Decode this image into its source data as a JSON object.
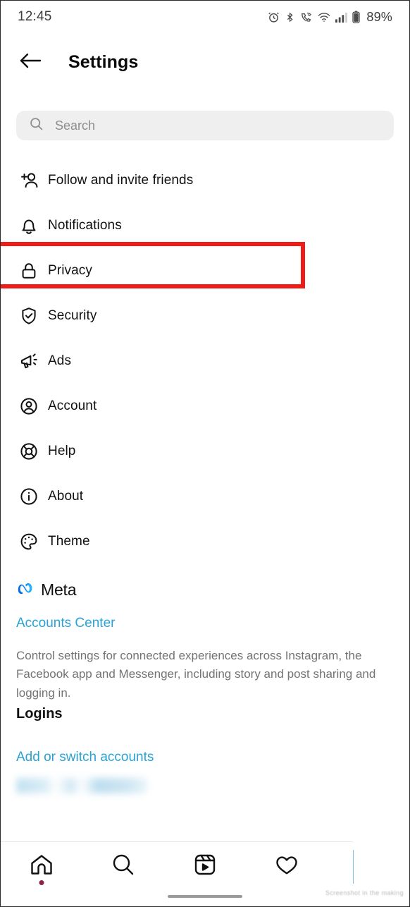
{
  "status_bar": {
    "time": "12:45",
    "battery_percent": "89%",
    "icons": [
      "alarm-icon",
      "bluetooth-icon",
      "vowifi-call-icon",
      "wifi-icon",
      "cellular-signal-icon",
      "battery-icon"
    ]
  },
  "app_bar": {
    "back_icon": "back-arrow-icon",
    "title": "Settings"
  },
  "search": {
    "icon": "search-icon",
    "placeholder": "Search",
    "value": ""
  },
  "menu": {
    "items": [
      {
        "label": "Follow and invite friends",
        "icon": "add-person-icon"
      },
      {
        "label": "Notifications",
        "icon": "bell-icon"
      },
      {
        "label": "Privacy",
        "icon": "lock-icon"
      },
      {
        "label": "Security",
        "icon": "shield-check-icon"
      },
      {
        "label": "Ads",
        "icon": "megaphone-icon"
      },
      {
        "label": "Account",
        "icon": "person-circle-icon"
      },
      {
        "label": "Help",
        "icon": "lifebuoy-icon"
      },
      {
        "label": "About",
        "icon": "info-circle-icon"
      },
      {
        "label": "Theme",
        "icon": "palette-icon"
      }
    ]
  },
  "highlight": {
    "target": "Privacy",
    "color": "#ed1c16"
  },
  "meta": {
    "logo_icon": "meta-infinity-icon",
    "brand": "Meta",
    "accounts_center_link": "Accounts Center",
    "description": "Control settings for connected experiences across Instagram, the Facebook app and Messenger, including story and post sharing and logging in."
  },
  "logins": {
    "title": "Logins",
    "add_switch_link": "Add or switch accounts",
    "redacted_account": ""
  },
  "bottom_nav": {
    "items": [
      {
        "name": "home",
        "icon": "home-icon",
        "badge_dot": true
      },
      {
        "name": "search",
        "icon": "search-icon",
        "badge_dot": false
      },
      {
        "name": "reels",
        "icon": "reels-icon",
        "badge_dot": false
      },
      {
        "name": "activity",
        "icon": "heart-icon",
        "badge_dot": false
      }
    ],
    "watermark": "Screenshot in the making"
  },
  "colors": {
    "link": "#2aa3d4",
    "highlight": "#ed1c16",
    "search_bg": "#efefef",
    "meta_blue": "#0081fb",
    "badge_dot": "#8c2247"
  }
}
